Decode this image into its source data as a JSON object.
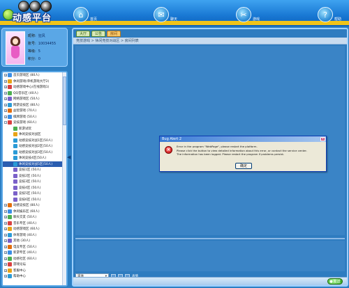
{
  "app": {
    "title": "动感平台"
  },
  "nav": [
    {
      "label": "首页",
      "icon": "home-icon",
      "glyph": "⌂"
    },
    {
      "label": "聊天",
      "icon": "chat-icon",
      "glyph": "✉"
    },
    {
      "label": "游戏",
      "icon": "tools-icon",
      "glyph": "✂"
    },
    {
      "label": "帮助",
      "icon": "help-icon",
      "glyph": "?"
    }
  ],
  "profile": {
    "rows": [
      {
        "key": "昵称:",
        "value": "狂风"
      },
      {
        "key": "账号:",
        "value": "10034455"
      },
      {
        "key": "等级:",
        "value": "5"
      },
      {
        "key": "积分:",
        "value": "0"
      }
    ]
  },
  "tree": [
    {
      "text": "首页游戏区 (80人)",
      "indent": 0,
      "pm": "+",
      "color": "#3a8ee6"
    },
    {
      "text": "休闲游戏(单机游戏大厅2)",
      "indent": 0,
      "pm": "+",
      "color": "#e8a317"
    },
    {
      "text": "动感游戏中心(在线游戏1)",
      "indent": 0,
      "pm": "+",
      "color": "#d94141"
    },
    {
      "text": "QQ音乐区 (40人)",
      "indent": 0,
      "pm": "+",
      "color": "#4caf50"
    },
    {
      "text": "网络游戏区 (50人)",
      "indent": 0,
      "pm": "+",
      "color": "#7b61c9"
    },
    {
      "text": "网游竞技区 (80人)",
      "indent": 0,
      "pm": "+",
      "color": "#2b9bd6"
    },
    {
      "text": "益智游戏 (70人)",
      "indent": 0,
      "pm": "+",
      "color": "#e46d0c"
    },
    {
      "text": "棋牌游戏 (50人)",
      "indent": 0,
      "pm": "+",
      "color": "#3a8ee6"
    },
    {
      "text": "竞技游戏 (60人)",
      "indent": 0,
      "pm": "-",
      "color": "#d94141"
    },
    {
      "text": "新游试玩",
      "indent": 1,
      "pm": "",
      "color": "#4caf50"
    },
    {
      "text": "休闲竞技对战区",
      "indent": 1,
      "pm": "",
      "color": "#e8a317"
    },
    {
      "text": "动感竞技对战1区(50人)",
      "indent": 1,
      "pm": "",
      "color": "#2b9bd6"
    },
    {
      "text": "动感竞技对战2区(50人)",
      "indent": 1,
      "pm": "",
      "color": "#2b9bd6"
    },
    {
      "text": "动感竞技对战3区(50人)",
      "indent": 1,
      "pm": "",
      "color": "#2b9bd6"
    },
    {
      "text": "休闲竞技4区(50人)",
      "indent": 1,
      "pm": "",
      "color": "#2b9bd6"
    },
    {
      "text": "休闲竞技对战5区(50人)",
      "indent": 1,
      "pm": "",
      "color": "#2b9bd6",
      "selected": true
    },
    {
      "text": "竞技1区 (50人)",
      "indent": 1,
      "pm": "",
      "color": "#7b61c9"
    },
    {
      "text": "竞技2区 (50人)",
      "indent": 1,
      "pm": "",
      "color": "#7b61c9"
    },
    {
      "text": "竞技3区 (50人)",
      "indent": 1,
      "pm": "",
      "color": "#7b61c9"
    },
    {
      "text": "竞技4区 (50人)",
      "indent": 1,
      "pm": "",
      "color": "#7b61c9"
    },
    {
      "text": "竞技5区 (50人)",
      "indent": 1,
      "pm": "",
      "color": "#7b61c9"
    },
    {
      "text": "竞技6区 (50人)",
      "indent": 1,
      "pm": "",
      "color": "#7b61c9"
    },
    {
      "text": "动感竞技区 (80人)",
      "indent": 0,
      "pm": "+",
      "color": "#e46d0c"
    },
    {
      "text": "休闲娱乐区 (60人)",
      "indent": 0,
      "pm": "+",
      "color": "#3a8ee6"
    },
    {
      "text": "聊天交友 (50人)",
      "indent": 0,
      "pm": "+",
      "color": "#4caf50"
    },
    {
      "text": "音乐专区 (40人)",
      "indent": 0,
      "pm": "+",
      "color": "#d94141"
    },
    {
      "text": "动感游戏区 (60人)",
      "indent": 0,
      "pm": "+",
      "color": "#e8a317"
    },
    {
      "text": "体育游戏 (40人)",
      "indent": 0,
      "pm": "+",
      "color": "#2b9bd6"
    },
    {
      "text": "其他 (30人)",
      "indent": 0,
      "pm": "+",
      "color": "#7b61c9"
    },
    {
      "text": "电竞专区 (50人)",
      "indent": 0,
      "pm": "+",
      "color": "#e46d0c"
    },
    {
      "text": "新游专区 (40人)",
      "indent": 0,
      "pm": "+",
      "color": "#3a8ee6"
    },
    {
      "text": "动感社区 (60人)",
      "indent": 0,
      "pm": "+",
      "color": "#4caf50"
    },
    {
      "text": "游戏论坛",
      "indent": 0,
      "pm": "+",
      "color": "#d94141"
    },
    {
      "text": "客服中心",
      "indent": 0,
      "pm": "+",
      "color": "#e8a317"
    },
    {
      "text": "帮助中心",
      "indent": 0,
      "pm": "+",
      "color": "#2b9bd6"
    }
  ],
  "tabs": [
    {
      "label": "大厅",
      "active": false
    },
    {
      "label": "公告",
      "active": false
    },
    {
      "label": "房间",
      "active": true
    }
  ],
  "breadcrumb": "竞技游戏 > 休闲竞技对战区 > 房间列表",
  "toolbar": {
    "font_value": "宋体",
    "label": "表情"
  },
  "send_button": {
    "label": "发送"
  },
  "dialog": {
    "title": "Bug Alert 2",
    "lines": [
      "Error in the program \"WebPage\", please restart the platform.",
      "Please click the button to view detailed information about this error, or contact the service center.",
      "The information has been logged. Please restart the program if problems persist."
    ],
    "ok_label": "确定"
  },
  "colors": {
    "header_top": "#3fa3f0",
    "header_band": "#f0c419",
    "main_bg": "#3a84c6",
    "tree_selected": "#2a5db0"
  }
}
